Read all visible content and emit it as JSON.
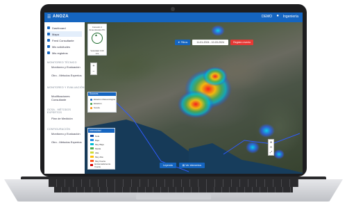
{
  "app": {
    "brand": "ANOZA",
    "demo_label": "DEMO",
    "user_label": "Ingeniería"
  },
  "compass_card": {
    "line1": "Conexión 1",
    "line2": "Zona Horaria UTC",
    "scale": "Velocidad: 0.00 m/s"
  },
  "sidebar": {
    "items": [
      {
        "label": "Dashboard",
        "active": false
      },
      {
        "label": "Mapa",
        "active": true
      },
      {
        "label": "Feed Consultante",
        "active": false
      },
      {
        "label": "Mis solicitudes",
        "active": false
      },
      {
        "label": "Mis registros",
        "active": false
      }
    ],
    "sections": [
      {
        "title": "MONITOREO TÉCNICO",
        "subitems": [
          "Monitoreo y Evaluación",
          "Otro - Métodos Expertos"
        ]
      },
      {
        "title": "MONITOREO Y EVALUACIÓN",
        "subitems": [
          "Modificaciones Consultante"
        ]
      },
      {
        "title": "OCSA - MÉTODOS EXPERTOS",
        "subitems": [
          "Plan de Medición"
        ]
      },
      {
        "title": "CONFIGURACIÓN",
        "subitems": [
          "Monitoreo y Evaluación",
          "Otro - Métodos Expertos"
        ]
      }
    ]
  },
  "mapbar": {
    "filter_label": "Filtros",
    "date_range": "11-01-2024 - 10-03-2024",
    "action_label": "Registro evento"
  },
  "legend_sources": {
    "title": "Sources",
    "items": [
      {
        "label": "Estación Meteorológica",
        "color": "#1565c0"
      },
      {
        "label": "Estación",
        "color": "#43a047"
      },
      {
        "label": "Sonda",
        "color": "#fb8c00"
      }
    ]
  },
  "legend_intensity": {
    "title": "Intensidad",
    "items": [
      {
        "label": "Nula",
        "color": "#0d47a1"
      },
      {
        "label": "Baja",
        "color": "#1e88e5"
      },
      {
        "label": "Muy Baja",
        "color": "#00bcd4"
      },
      {
        "label": "Media",
        "color": "#4caf50"
      },
      {
        "label": "Alta",
        "color": "#cddc39"
      },
      {
        "label": "Muy Alta",
        "color": "#ffc107"
      },
      {
        "label": "Muy Fuerte",
        "color": "#ff5722"
      },
      {
        "label": "Extremadamente Fuerte",
        "color": "#d50000"
      }
    ]
  },
  "bottombar": {
    "left_label": "Leyenda",
    "right_label": "Ver elementos"
  }
}
